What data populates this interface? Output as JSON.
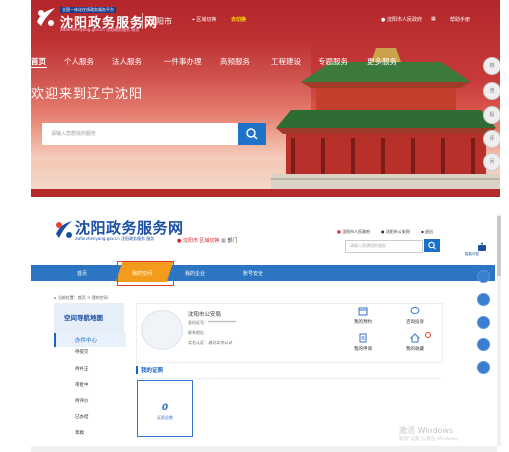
{
  "portal": {
    "logo": {
      "subtitle": "全国一体化在线政务服务平台",
      "title": "沈阳政务服务网",
      "url": "zwfw.shenyang.gov.cn 沈阳政务服务 服务"
    },
    "city": "沈阳市",
    "location": "区域切换",
    "city_switch": "去切换",
    "top_links": [
      "沈阳市人民政府",
      "帮助手册"
    ],
    "nav": [
      "首页",
      "个人服务",
      "法人服务",
      "一件事办理",
      "高频服务",
      "工程建设",
      "专题服务",
      "更多服务"
    ],
    "welcome": "欢迎来到辽宁沈阳",
    "search_placeholder": "请输入您想找的服务",
    "side_tools": [
      "热",
      "咨",
      "投",
      "评",
      "问"
    ]
  },
  "window": {
    "logo": {
      "title": "沈阳政务服务网",
      "url": "zwfw.shenyang.gov.cn 沈阳政务服务 服务"
    },
    "city": "沈阳市 区域切换",
    "dept": "部门",
    "top_links": [
      "沈阳市人民政府",
      "沈阳市公安网",
      "退出"
    ],
    "search_placeholder": "请输入您想找的服务",
    "nav": [
      "首页",
      "我的空间",
      "我的企业",
      "账号安全"
    ],
    "breadcrumb": "当前位置：首页 > 我的空间",
    "sidebar_title": "空间导航地图",
    "menu": [
      "办件中心",
      "待提交",
      "待补正",
      "审批中",
      "待评价",
      "已办结",
      "草稿"
    ],
    "user": {
      "name": "沈阳市公安局",
      "id_label": "身份证号：",
      "id_value": "**************",
      "phone_label": "联系地址：",
      "auth_label": "实名认证：",
      "auth_value": "通过实名认证"
    },
    "quick_tiles": [
      "我的预约",
      "咨询投诉",
      "我的申请",
      "我的收藏"
    ],
    "licence_section": "我的证照",
    "licence_count": "0",
    "licence_label": "证照总数",
    "right_tag": "智能问答",
    "right_tools": [
      "看",
      "查",
      "办",
      "问",
      "评"
    ],
    "watermark": "激活 Windows",
    "watermark_sub": "转到“设置”以激活 Windows。"
  },
  "colors": {
    "portal_red": "#c63a39",
    "brand_blue": "#1b4fa3",
    "nav_blue": "#2c75c2",
    "active_orange": "#f39b1b",
    "highlight_red": "#e23a2a"
  }
}
